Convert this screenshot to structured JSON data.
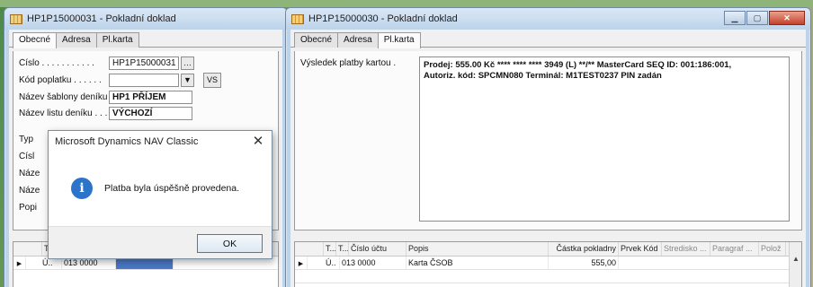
{
  "left_window": {
    "title": "HP1P15000031 - Pokladní doklad",
    "tabs": [
      {
        "label": "Obecné",
        "active": true
      },
      {
        "label": "Adresa",
        "active": false
      },
      {
        "label": "Pl.karta",
        "active": false
      }
    ],
    "fields": {
      "cislo": {
        "label": "Číslo . . . . . . . . . . .",
        "value": "HP1P15000031"
      },
      "kod_poplatku": {
        "label": "Kód poplatku . . . . . .",
        "value": ""
      },
      "nazev_sablony": {
        "label": "Název šablony deníku . .",
        "value": "HP1 PŘÍJEM"
      },
      "nazev_listu": {
        "label": "Název listu deníku . . . .",
        "value": "VÝCHOZÍ"
      },
      "typ": {
        "label": "Typ"
      },
      "cislo2": {
        "label": "Čísl"
      },
      "naze1": {
        "label": "Náze"
      },
      "naze2": {
        "label": "Náze"
      },
      "popis": {
        "label": "Popi"
      }
    },
    "vs_button": "VS",
    "grid": {
      "headers": [
        "T",
        "T"
      ],
      "row": {
        "c1": "Ú..",
        "c2": "013 0000"
      }
    }
  },
  "dialog": {
    "title": "Microsoft Dynamics NAV Classic",
    "message": "Platba byla úspěšně provedena.",
    "ok_label": "OK",
    "close_glyph": "✕",
    "icon": "info-icon"
  },
  "right_window": {
    "title": "HP1P15000030 - Pokladní doklad",
    "tabs": [
      {
        "label": "Obecné",
        "active": false
      },
      {
        "label": "Adresa",
        "active": false
      },
      {
        "label": "Pl.karta",
        "active": true
      }
    ],
    "memo_label": "Výsledek platby kartou  .",
    "memo_lines": [
      "Prodej: 555.00 Kč **** **** **** 3949 (L) **/** MasterCard SEQ ID: 001:186:001,",
      "Autoriz. kód: SPCMN080 Terminál: M1TEST0237 PIN zadán"
    ],
    "grid": {
      "headers": [
        "T...",
        "T...",
        "Číslo účtu",
        "Popis",
        "Částka pokladny",
        "Prvek Kód",
        "Stredisko ...",
        "Paragraf ...",
        "Polož"
      ],
      "row": [
        "Ú..",
        "013 0000",
        "Karta ČSOB",
        "555,00"
      ]
    }
  },
  "colors": {
    "titlebar": "#bcd3ea",
    "close_button": "#c5402a",
    "info_icon": "#2b74c9"
  }
}
